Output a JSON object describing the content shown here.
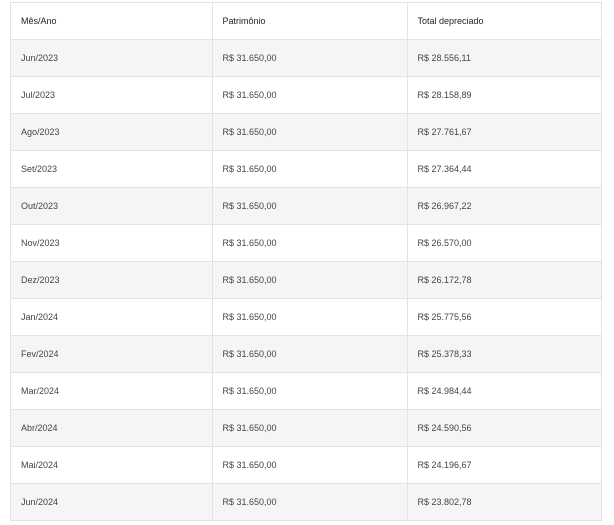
{
  "table": {
    "headers": [
      "Mês/Ano",
      "Patrimônio",
      "Total depreciado"
    ],
    "rows": [
      [
        "Jun/2023",
        "R$ 31.650,00",
        "R$ 28.556,11"
      ],
      [
        "Jul/2023",
        "R$ 31.650,00",
        "R$ 28.158,89"
      ],
      [
        "Ago/2023",
        "R$ 31.650,00",
        "R$ 27.761,67"
      ],
      [
        "Set/2023",
        "R$ 31.650,00",
        "R$ 27.364,44"
      ],
      [
        "Out/2023",
        "R$ 31.650,00",
        "R$ 26.967,22"
      ],
      [
        "Nov/2023",
        "R$ 31.650,00",
        "R$ 26.570,00"
      ],
      [
        "Dez/2023",
        "R$ 31.650,00",
        "R$ 26.172,78"
      ],
      [
        "Jan/2024",
        "R$ 31.650,00",
        "R$ 25.775,56"
      ],
      [
        "Fev/2024",
        "R$ 31.650,00",
        "R$ 25.378,33"
      ],
      [
        "Mar/2024",
        "R$ 31.650,00",
        "R$ 24.984,44"
      ],
      [
        "Abr/2024",
        "R$ 31.650,00",
        "R$ 24.590,56"
      ],
      [
        "Mai/2024",
        "R$ 31.650,00",
        "R$ 24.196,67"
      ],
      [
        "Jun/2024",
        "R$ 31.650,00",
        "R$ 23.802,78"
      ]
    ]
  }
}
